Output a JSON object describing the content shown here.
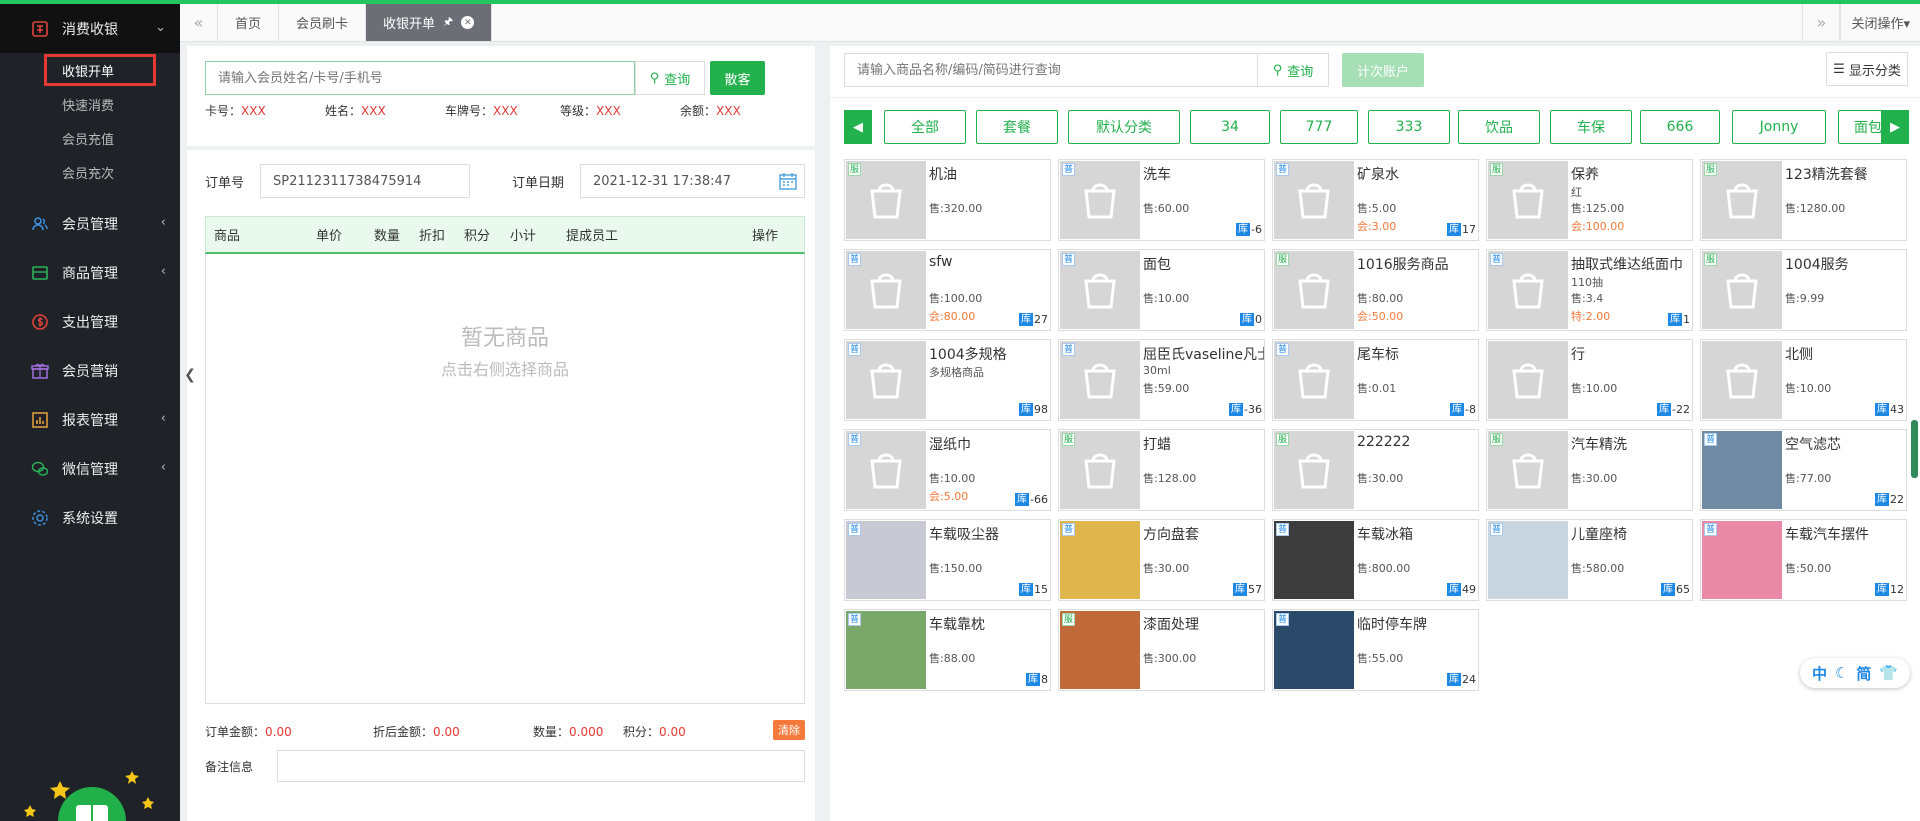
{
  "sidebar": {
    "menus": [
      {
        "label": "消费收银",
        "icon": "cashier-icon",
        "arrow": "⌄",
        "open": true
      },
      {
        "label": "会员管理",
        "icon": "member-icon",
        "arrow": "‹"
      },
      {
        "label": "商品管理",
        "icon": "product-icon",
        "arrow": "‹"
      },
      {
        "label": "支出管理",
        "icon": "expense-icon",
        "arrow": ""
      },
      {
        "label": "会员营销",
        "icon": "gift-icon",
        "arrow": ""
      },
      {
        "label": "报表管理",
        "icon": "report-icon",
        "arrow": "‹"
      },
      {
        "label": "微信管理",
        "icon": "wechat-icon",
        "arrow": "‹"
      },
      {
        "label": "系统设置",
        "icon": "settings-icon",
        "arrow": ""
      }
    ],
    "submenu": [
      "收银开单",
      "快速消费",
      "会员充值",
      "会员充次"
    ]
  },
  "tabs": {
    "prev": "«",
    "items": [
      "首页",
      "会员刷卡",
      "收银开单"
    ],
    "active_pin": "🖈",
    "active_close": "✕",
    "next": "»",
    "close_ops": "关闭操作▾"
  },
  "member": {
    "search_placeholder": "请输入会员姓名/卡号/手机号",
    "query_label": "查询",
    "walkin_label": "散客",
    "fields": [
      {
        "label": "卡号：",
        "value": "XXX"
      },
      {
        "label": "姓名：",
        "value": "XXX"
      },
      {
        "label": "车牌号：",
        "value": "XXX"
      },
      {
        "label": "等级：",
        "value": "XXX"
      },
      {
        "label": "余额：",
        "value": "XXX"
      }
    ]
  },
  "order": {
    "no_label": "订单号",
    "no_value": "SP2112311738475914",
    "date_label": "订单日期",
    "date_value": "2021-12-31 17:38:47",
    "columns": [
      "商品",
      "单价",
      "数量",
      "折扣",
      "积分",
      "小计",
      "提成员工",
      "操作"
    ],
    "empty_title": "暂无商品",
    "empty_hint": "点击右侧选择商品",
    "summary": [
      {
        "label": "订单金额：",
        "value": "0.00"
      },
      {
        "label": "折后金额：",
        "value": "0.00"
      },
      {
        "label": "数量：",
        "value": "0.000"
      },
      {
        "label": "积分：",
        "value": "0.00"
      }
    ],
    "clear_label": "清除",
    "remark_label": "备注信息"
  },
  "products_panel": {
    "search_placeholder": "请输入商品名称/编码/简码进行查询",
    "query_label": "查询",
    "count_label": "计次账户",
    "show_cat_label": "显示分类",
    "categories": [
      "全部",
      "套餐",
      "默认分类",
      "34",
      "777",
      "333",
      "饮品",
      "车保",
      "666",
      "Jonny",
      "面包"
    ],
    "cards": [
      {
        "tag": "服",
        "name": "机油",
        "sub": "",
        "price": "售:320.00",
        "price2": "",
        "stock": ""
      },
      {
        "tag": "普",
        "name": "洗车",
        "sub": "",
        "price": "售:60.00",
        "price2": "",
        "stock": "-6"
      },
      {
        "tag": "普",
        "name": "矿泉水",
        "sub": "",
        "price": "售:5.00",
        "price2": "会:3.00",
        "stock": "17"
      },
      {
        "tag": "服",
        "name": "保养",
        "sub": "红",
        "price": "售:125.00",
        "price2": "会:100.00",
        "stock": ""
      },
      {
        "tag": "服",
        "name": "123精洗套餐",
        "sub": "",
        "price": "售:1280.00",
        "price2": "",
        "stock": ""
      },
      {
        "tag": "普",
        "name": "sfw",
        "sub": "",
        "price": "售:100.00",
        "price2": "会:80.00",
        "stock": "27"
      },
      {
        "tag": "普",
        "name": "面包",
        "sub": "",
        "price": "售:10.00",
        "price2": "",
        "stock": "0"
      },
      {
        "tag": "服",
        "name": "1016服务商品",
        "sub": "",
        "price": "售:80.00",
        "price2": "会:50.00",
        "stock": ""
      },
      {
        "tag": "普",
        "name": "抽取式维达纸面巾",
        "sub": "110抽",
        "price": "售:3.4",
        "price2": "特:2.00",
        "stock": "1"
      },
      {
        "tag": "服",
        "name": "1004服务",
        "sub": "",
        "price": "售:9.99",
        "price2": "",
        "stock": ""
      },
      {
        "tag": "普",
        "name": "1004多规格",
        "sub": "多规格商品",
        "price": "",
        "price2": "",
        "stock": "98"
      },
      {
        "tag": "普",
        "name": "屈臣氏vaseline凡士",
        "sub": "30ml",
        "price": "售:59.00",
        "price2": "",
        "stock": "-36"
      },
      {
        "tag": "普",
        "name": "尾车标",
        "sub": "",
        "price": "售:0.01",
        "price2": "",
        "stock": "-8"
      },
      {
        "tag": "",
        "name": "行",
        "sub": "",
        "price": "售:10.00",
        "price2": "",
        "stock": "-22"
      },
      {
        "tag": "",
        "name": "北侧",
        "sub": "",
        "price": "售:10.00",
        "price2": "",
        "stock": "43"
      },
      {
        "tag": "普",
        "name": "湿纸巾",
        "sub": "",
        "price": "售:10.00",
        "price2": "会:5.00",
        "stock": "-66"
      },
      {
        "tag": "服",
        "name": "打蜡",
        "sub": "",
        "price": "售:128.00",
        "price2": "",
        "stock": ""
      },
      {
        "tag": "服",
        "name": "222222",
        "sub": "",
        "price": "售:30.00",
        "price2": "",
        "stock": ""
      },
      {
        "tag": "服",
        "name": "汽车精洗",
        "sub": "",
        "price": "售:30.00",
        "price2": "",
        "stock": ""
      },
      {
        "tag": "普",
        "name": "空气滤芯",
        "sub": "",
        "price": "售:77.00",
        "price2": "",
        "stock": "22"
      },
      {
        "tag": "普",
        "name": "车载吸尘器",
        "sub": "",
        "price": "售:150.00",
        "price2": "",
        "stock": "15"
      },
      {
        "tag": "普",
        "name": "方向盘套",
        "sub": "",
        "price": "售:30.00",
        "price2": "",
        "stock": "57"
      },
      {
        "tag": "普",
        "name": "车载冰箱",
        "sub": "",
        "price": "售:800.00",
        "price2": "",
        "stock": "49"
      },
      {
        "tag": "普",
        "name": "儿童座椅",
        "sub": "",
        "price": "售:580.00",
        "price2": "",
        "stock": "65"
      },
      {
        "tag": "普",
        "name": "车载汽车摆件",
        "sub": "",
        "price": "售:50.00",
        "price2": "",
        "stock": "12"
      },
      {
        "tag": "普",
        "name": "车载靠枕",
        "sub": "",
        "price": "售:88.00",
        "price2": "",
        "stock": "8"
      },
      {
        "tag": "服",
        "name": "漆面处理",
        "sub": "",
        "price": "售:300.00",
        "price2": "",
        "stock": ""
      },
      {
        "tag": "普",
        "name": "临时停车牌",
        "sub": "",
        "price": "售:55.00",
        "price2": "",
        "stock": "24"
      }
    ],
    "stock_label": "库",
    "lang_badge": [
      "中",
      "☾",
      "简",
      "👕"
    ]
  },
  "colors": {
    "brand": "#23b14d",
    "sidebar": "#1f2227",
    "warn": "#e53935",
    "member_price": "#f4793b",
    "stock": "#1e88e5"
  }
}
